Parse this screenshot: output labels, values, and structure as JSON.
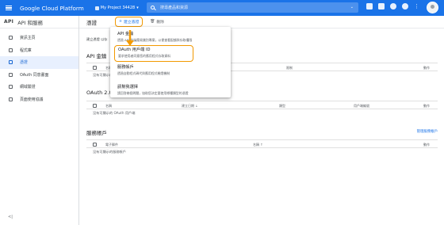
{
  "topbar": {
    "brand": "Google Cloud Platform",
    "project": "My Project 34428",
    "search_placeholder": "搜尋產品和資源"
  },
  "sidebar": {
    "header_api": "API",
    "header_title": "API 和服務",
    "items": [
      {
        "label": "資訊主頁",
        "icon": "dashboard-icon"
      },
      {
        "label": "程式庫",
        "icon": "library-icon"
      },
      {
        "label": "憑證",
        "icon": "key-icon",
        "active": true
      },
      {
        "label": "OAuth 同意畫面",
        "icon": "consent-icon"
      },
      {
        "label": "網域驗證",
        "icon": "checkbox-icon"
      },
      {
        "label": "頁面使用協議",
        "icon": "settings-icon"
      }
    ],
    "collapse": "<|"
  },
  "toolbar": {
    "title": "憑證",
    "create_label": "建立憑證",
    "delete_label": "刪除"
  },
  "description": "建立憑證 以存",
  "sections": {
    "api_keys": {
      "title": "API 金鑰",
      "headers": [
        "名稱",
        "限制",
        "動作"
      ],
      "empty": "沒有可顯示的 API 金鑰"
    },
    "oauth": {
      "title": "OAuth 2.0",
      "headers": [
        "名稱",
        "建立日期",
        "類型",
        "用戶端編號",
        "動作"
      ],
      "empty": "沒有可顯示的 OAuth 用戶端"
    },
    "service_accounts": {
      "title": "服務帳戶",
      "manage_link": "管理服務帳戶",
      "headers": [
        "電子郵件",
        "名稱",
        "動作"
      ],
      "empty": "沒有可顯示的服務帳戶"
    }
  },
  "create_menu": {
    "items": [
      {
        "title": "API 金鑰",
        "desc": "透過 API 金鑰簡易識別專案，以便查看配額與存取權限"
      },
      {
        "title": "OAuth 用戶端 ID",
        "desc": "要求使用者同意您的應用程式存取資料",
        "highlighted": true
      },
      {
        "title": "服務帳戶",
        "desc": "透過自動程式碼代與應用程式驗證機制"
      },
      {
        "title": "請幫我選擇",
        "desc": "請回答幾個問題，協助您決定要使用哪種類型的憑證"
      }
    ]
  },
  "colors": {
    "brand_blue": "#1a73e8",
    "highlight_orange": "#f29900"
  }
}
